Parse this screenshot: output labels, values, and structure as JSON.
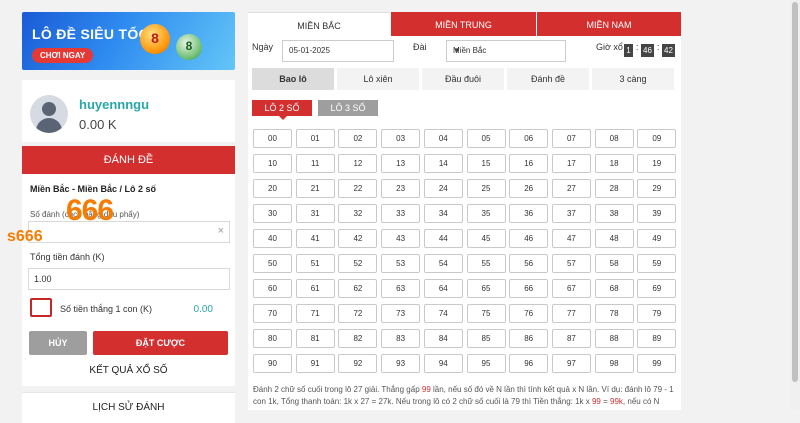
{
  "banner": {
    "title": "LÔ ĐỀ SIÊU TỐC",
    "button": "CHƠI NGAY",
    "ball1": "8",
    "ball2": "8"
  },
  "user": {
    "name": "huyennngu",
    "balance": "0.00 K"
  },
  "bet": {
    "header": "ĐÁNH ĐỀ",
    "selection": "Miền Bắc - Miền Bắc / Lô 2 số",
    "input_hint": "Số đánh (cách bằng dấu phẩy)",
    "clear_icon": "×",
    "total_label": "Tổng tiền đánh (K)",
    "total_value": "1.00",
    "win_label": "Số tiền thắng 1 con (K)",
    "win_value": "0.00",
    "cancel": "HỦY",
    "submit": "ĐẶT CƯỢC"
  },
  "watermark": {
    "big": "666",
    "small": "s666"
  },
  "side_links": [
    "KẾT QUẢ XỔ SỐ",
    "LỊCH SỬ ĐÁNH"
  ],
  "regions": [
    "MIỀN BẮC",
    "MIỀN TRUNG",
    "MIỀN NAM"
  ],
  "filters": {
    "date_label": "Ngày",
    "date_value": "05-01-2025",
    "station_label": "Đài",
    "station_value": "Miền Bắc",
    "time_label": "Giờ xổ",
    "time": [
      "1",
      "46",
      "42"
    ]
  },
  "bet_types": [
    "Bao lô",
    "Lô xiên",
    "Đầu đuôi",
    "Đánh đề",
    "3 càng"
  ],
  "lo_types": [
    "LÔ 2 SỐ",
    "LÔ 3 SỐ"
  ],
  "numbers": [
    "00",
    "01",
    "02",
    "03",
    "04",
    "05",
    "06",
    "07",
    "08",
    "09",
    "10",
    "11",
    "12",
    "13",
    "14",
    "15",
    "16",
    "17",
    "18",
    "19",
    "20",
    "21",
    "22",
    "23",
    "24",
    "25",
    "26",
    "27",
    "28",
    "29",
    "30",
    "31",
    "32",
    "33",
    "34",
    "35",
    "36",
    "37",
    "38",
    "39",
    "40",
    "41",
    "42",
    "43",
    "44",
    "45",
    "46",
    "47",
    "48",
    "49",
    "50",
    "51",
    "52",
    "53",
    "54",
    "55",
    "56",
    "57",
    "58",
    "59",
    "60",
    "61",
    "62",
    "63",
    "64",
    "65",
    "66",
    "67",
    "68",
    "69",
    "70",
    "71",
    "72",
    "73",
    "74",
    "75",
    "76",
    "77",
    "78",
    "79",
    "80",
    "81",
    "82",
    "83",
    "84",
    "85",
    "86",
    "87",
    "88",
    "89",
    "90",
    "91",
    "92",
    "93",
    "94",
    "95",
    "96",
    "97",
    "98",
    "99"
  ],
  "note": {
    "p1": "Đánh 2 chữ số cuối trong lô 27 giải. Thắng gấp ",
    "h1": "99",
    "p2": " lần, nếu số đó về N lần thì tính kết quả x N lần. Ví dụ: đánh lô 79 - 1 con 1k, Tổng thanh toán: 1k x 27 = 27k. Nếu trong lô có 2 chữ số cuối là 79 thì Tiền thắng: 1k x ",
    "h2": "99",
    "p3": " = ",
    "h3": "99k",
    "p4": ", nếu có N"
  },
  "colors": {
    "red": "#d32f2f",
    "teal": "#2aa7a7",
    "orange": "#f57c00"
  }
}
